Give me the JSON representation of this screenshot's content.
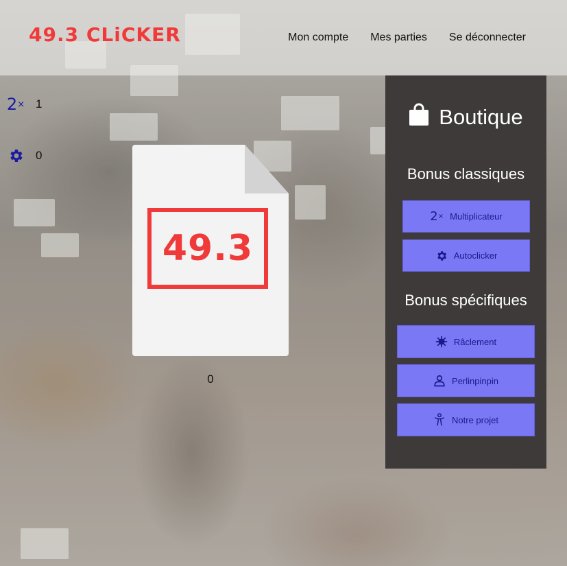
{
  "header": {
    "logo": "49.3 CLiCKER",
    "nav": [
      "Mon compte",
      "Mes parties",
      "Se déconnecter"
    ]
  },
  "stats": {
    "multiplier": {
      "icon": "multiplier-2x-icon",
      "icon_main": "2",
      "icon_sub": "×",
      "value": "1"
    },
    "autoclicker": {
      "icon": "gear-icon",
      "value": "0"
    }
  },
  "clicker": {
    "label": "49.3",
    "count": "0"
  },
  "shop": {
    "title": "Boutique",
    "icon": "shopping-bag-icon",
    "classic_heading": "Bonus classiques",
    "classic": [
      {
        "label": "Multiplicateur",
        "icon": "multiplier-2x-icon"
      },
      {
        "label": "Autoclicker",
        "icon": "gear-icon"
      }
    ],
    "specific_heading": "Bonus spécifiques",
    "specific": [
      {
        "label": "Râclement",
        "icon": "virus-icon"
      },
      {
        "label": "Perlinpinpin",
        "icon": "person-icon"
      },
      {
        "label": "Notre projet",
        "icon": "figure-icon"
      }
    ]
  },
  "colors": {
    "brand_red": "#f03a3a",
    "button": "#7b78f5",
    "button_text": "#1a1a8c",
    "shop_bg": "#3d3a39",
    "stat_icon": "#1a1aa0"
  }
}
